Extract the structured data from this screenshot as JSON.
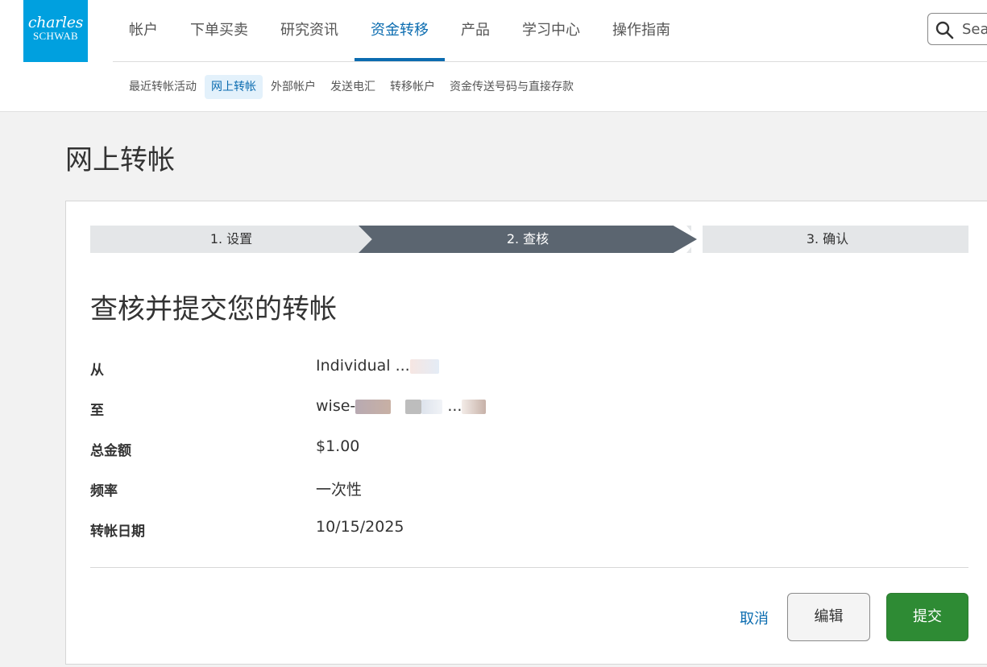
{
  "brand": {
    "logo_line1": "charles",
    "logo_line2": "SCHWAB",
    "color": "#00a0df"
  },
  "main_nav": [
    {
      "label": "帐户"
    },
    {
      "label": "下单买卖"
    },
    {
      "label": "研究资讯"
    },
    {
      "label": "资金转移",
      "active": true
    },
    {
      "label": "产品"
    },
    {
      "label": "学习中心"
    },
    {
      "label": "操作指南"
    }
  ],
  "search": {
    "text": "Sea",
    "icon": "search-icon"
  },
  "sub_nav": [
    {
      "label": "最近转帐活动"
    },
    {
      "label": "网上转帐",
      "active": true
    },
    {
      "label": "外部帐户"
    },
    {
      "label": "发送电汇"
    },
    {
      "label": "转移帐户"
    },
    {
      "label": "资金传送号码与直接存款"
    }
  ],
  "page_title": "网上转帐",
  "steps": [
    {
      "label": "1. 设置"
    },
    {
      "label": "2. 查核",
      "active": true
    },
    {
      "label": "3. 确认"
    }
  ],
  "section_title": "查核并提交您的转帐",
  "details": [
    {
      "label": "从",
      "value": "Individual ..."
    },
    {
      "label": "至",
      "value": "wise-",
      "value_suffix": "..."
    },
    {
      "label": "总金额",
      "value": "$1.00"
    },
    {
      "label": "频率",
      "value": "一次性"
    },
    {
      "label": "转帐日期",
      "value": "10/15/2025"
    }
  ],
  "actions": {
    "cancel": "取消",
    "edit": "编辑",
    "submit": "提交"
  },
  "colors": {
    "accent": "#0b6cb0",
    "step_active": "#5b6570",
    "submit": "#2e8b34"
  }
}
